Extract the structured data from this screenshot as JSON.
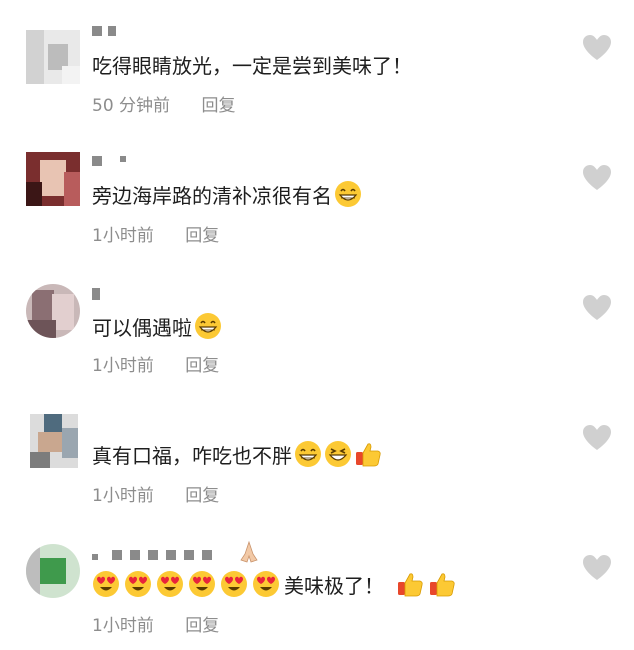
{
  "comments": [
    {
      "text": "吃得眼睛放光，一定是尝到美味了！",
      "time": "50 分钟前",
      "reply": "回复",
      "emojis": [],
      "trailing_text": "",
      "trailing_emojis": []
    },
    {
      "text": "旁边海岸路的清补凉很有名",
      "time": "1小时前",
      "reply": "回复",
      "emojis": [
        "grin-emoji"
      ],
      "trailing_text": "",
      "trailing_emojis": []
    },
    {
      "text": "可以偶遇啦",
      "time": "1小时前",
      "reply": "回复",
      "emojis": [
        "grin-emoji"
      ],
      "trailing_text": "",
      "trailing_emojis": []
    },
    {
      "text": "真有口福，咋吃也不胖",
      "time": "1小时前",
      "reply": "回复",
      "emojis": [
        "grin-emoji",
        "squint-grin-emoji",
        "thumbs-up-emoji"
      ],
      "trailing_text": "",
      "trailing_emojis": []
    },
    {
      "text": "",
      "time": "1小时前",
      "reply": "回复",
      "emojis": [
        "heart-eyes-emoji",
        "heart-eyes-emoji",
        "heart-eyes-emoji",
        "heart-eyes-emoji",
        "heart-eyes-emoji",
        "heart-eyes-emoji"
      ],
      "trailing_text": "美味极了！",
      "trailing_emojis": [
        "thumbs-up-emoji",
        "thumbs-up-emoji"
      ]
    }
  ],
  "colors": {
    "text": "#1e1e1e",
    "meta": "#8d8d8d",
    "heart": "#d0d0d0",
    "emoji_yellow": "#fcc934"
  }
}
